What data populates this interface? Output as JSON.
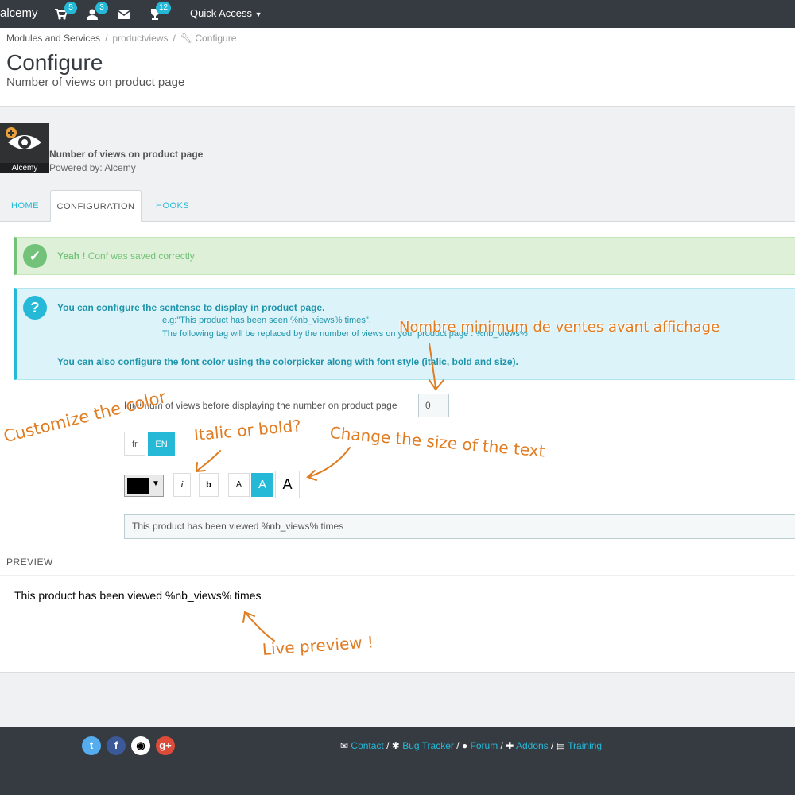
{
  "topbar": {
    "brand": "alcemy",
    "cart_count": "5",
    "users_count": "3",
    "trophy_count": "12",
    "quick_access": "Quick Access"
  },
  "breadcrumb": {
    "item1": "Modules and Services",
    "item2": "productviews",
    "item3": "Configure"
  },
  "page": {
    "title": "Configure",
    "subtitle": "Number of views on product page"
  },
  "module": {
    "logo_text": "Alcemy",
    "name": "Number of views on product page",
    "powered": "Powered by: Alcemy"
  },
  "tabs": [
    "HOME",
    "CONFIGURATION",
    "HOOKS"
  ],
  "alerts": {
    "success_strong": "Yeah !",
    "success_text": "Conf was saved correctly",
    "info_line1": "You can configure the sentense to display in product page.",
    "info_line2": "e.g:\"This product has been seen %nb_views% times\".",
    "info_line3": "The following tag will be replaced by the number of views on your product page : %nb_views%",
    "info_line4": "You can also configure the font color using the colorpicker along with font style (italic, bold and size)."
  },
  "form": {
    "min_label": "Minimum of views before displaying the number on product page",
    "min_value": "0",
    "lang_fr": "fr",
    "lang_en": "EN",
    "italic": "i",
    "bold": "b",
    "size_small": "A",
    "size_medium": "A",
    "size_large": "A",
    "sentence": "This product has been viewed %nb_views% times",
    "selected_color": "#000000"
  },
  "preview": {
    "heading": "PREVIEW",
    "text": "This product has been viewed %nb_views% times"
  },
  "annotations": {
    "min_sales": "Nombre minimum de ventes avant affichage",
    "color": "Customize the color",
    "italic_bold": "Italic or bold?",
    "size": "Change the size of the text",
    "live": "Live preview !"
  },
  "footer": {
    "contact": "Contact",
    "bug_tracker": "Bug Tracker",
    "forum": "Forum",
    "addons": "Addons",
    "training": "Training",
    "sep": "/"
  },
  "colors": {
    "accent": "#25b9d7",
    "success": "#72c279",
    "annotation": "#e07c22",
    "topbar": "#363a41"
  }
}
